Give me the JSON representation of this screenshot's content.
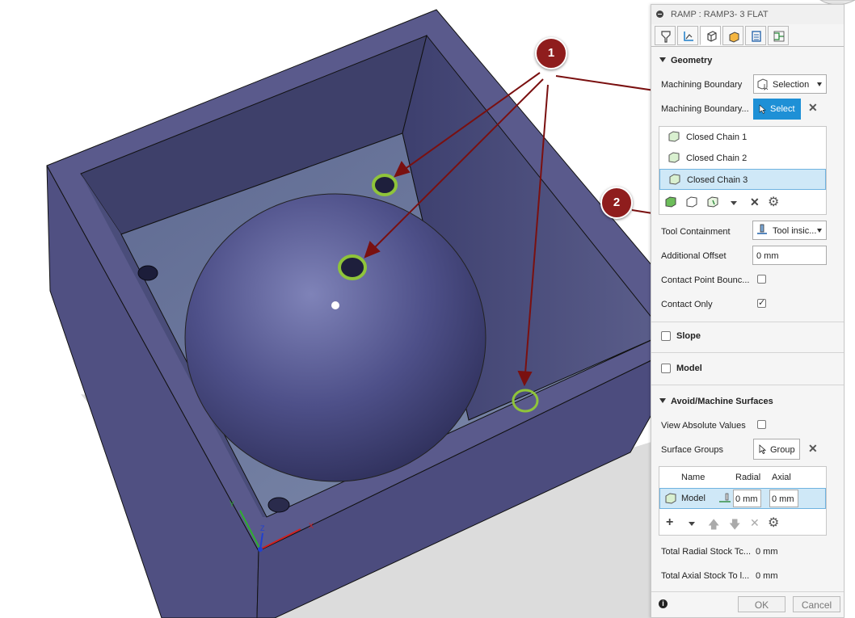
{
  "panel": {
    "title": "RAMP : RAMP3- 3 FLAT",
    "tabs": [
      "tool-icon",
      "tool-path-icon",
      "geometry-icon",
      "heights-icon",
      "passes-icon",
      "linking-icon"
    ],
    "geometry": {
      "section_label": "Geometry",
      "machining_boundary_label": "Machining Boundary",
      "machining_boundary_value": "Selection",
      "machining_boundary_sel_label": "Machining Boundary...",
      "select_button": "Select",
      "chains": [
        "Closed Chain 1",
        "Closed Chain 2",
        "Closed Chain 3"
      ],
      "selected_chain": "Closed Chain 3",
      "tool_containment_label": "Tool Containment",
      "tool_containment_value": "Tool insic...",
      "additional_offset_label": "Additional Offset",
      "additional_offset_value": "0 mm",
      "contact_point_label": "Contact Point Bounc...",
      "contact_point_checked": false,
      "contact_only_label": "Contact Only",
      "contact_only_checked": true
    },
    "slope": {
      "label": "Slope",
      "checked": false
    },
    "model": {
      "label": "Model",
      "checked": false
    },
    "avoid": {
      "section_label": "Avoid/Machine Surfaces",
      "view_absolute_label": "View Absolute Values",
      "view_absolute_checked": false,
      "surface_groups_label": "Surface Groups",
      "group_button": "Group",
      "table_headers": [
        "Name",
        "Radial",
        "Axial"
      ],
      "rows": [
        {
          "name": "Model",
          "radial": "0 mm",
          "axial": "0 mm"
        }
      ],
      "total_radial_label": "Total Radial Stock Tc...",
      "total_radial_value": "0 mm",
      "total_axial_label": "Total Axial Stock To l...",
      "total_axial_value": "0 mm"
    },
    "footer": {
      "ok": "OK",
      "cancel": "Cancel"
    }
  },
  "annotations": {
    "marker1": "1",
    "marker2": "2"
  },
  "axes": {
    "x": "X",
    "y": "Y",
    "z": "Z"
  },
  "colors": {
    "accent": "#1e90d6",
    "marker": "#8f1d1d",
    "arrow": "#7a1010",
    "model": "#4a4a7e",
    "highlight": "#8fc43a"
  }
}
